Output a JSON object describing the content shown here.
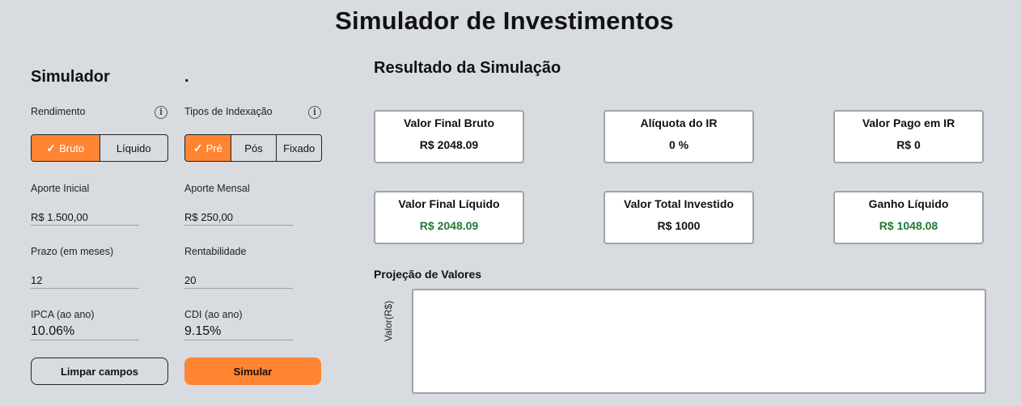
{
  "page": {
    "title": "Simulador de Investimentos"
  },
  "simulator": {
    "heading": "Simulador",
    "heading2": ".",
    "rendimento": {
      "label": "Rendimento",
      "options": [
        "Bruto",
        "Líquido"
      ],
      "selected": "Bruto"
    },
    "indexacao": {
      "label": "Tipos de Indexação",
      "options": [
        "Pré",
        "Pós",
        "Fixado"
      ],
      "selected": "Pré"
    },
    "check_glyph": "✓",
    "info_glyph": "i",
    "fields": {
      "aporte_inicial": {
        "label": "Aporte Inicial",
        "value": "R$ 1.500,00"
      },
      "aporte_mensal": {
        "label": "Aporte Mensal",
        "value": "R$ 250,00"
      },
      "prazo": {
        "label": "Prazo (em meses)",
        "value": "12"
      },
      "rentabilidade": {
        "label": "Rentabilidade",
        "value": "20"
      },
      "ipca": {
        "label": "IPCA (ao ano)",
        "value": "10.06%"
      },
      "cdi": {
        "label": "CDI (ao ano)",
        "value": "9.15%"
      }
    },
    "buttons": {
      "clear": "Limpar campos",
      "simulate": "Simular"
    }
  },
  "results": {
    "title": "Resultado da Simulação",
    "cards": [
      {
        "title": "Valor Final Bruto",
        "value": "R$ 2048.09"
      },
      {
        "title": "Alíquota do IR",
        "value": "0 %"
      },
      {
        "title": "Valor Pago em IR",
        "value": "R$ 0"
      },
      {
        "title": "Valor Final Líquido",
        "value": "R$ 2048.09"
      },
      {
        "title": "Valor Total Investido",
        "value": "R$ 1000"
      },
      {
        "title": "Ganho Líquido",
        "value": "R$ 1048.08"
      }
    ],
    "projection": {
      "title": "Projeção de Valores",
      "ylabel": "Valor(R$)"
    }
  },
  "colors": {
    "accent": "#ff8533",
    "positive": "#1f7a33",
    "background": "#d8dce1"
  }
}
